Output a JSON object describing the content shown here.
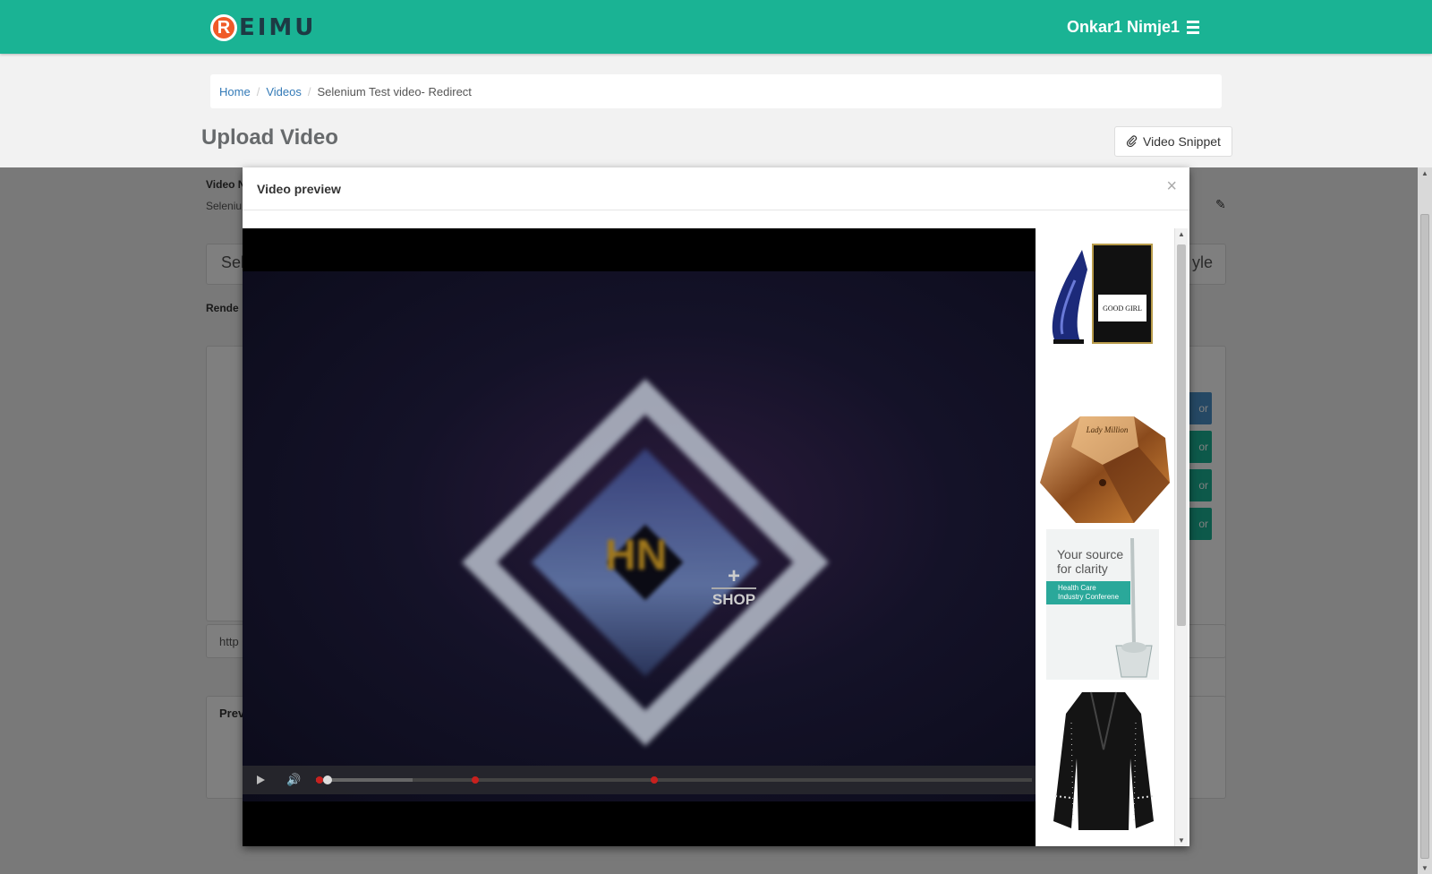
{
  "app": {
    "logo_letter": "R",
    "logo_text": "EIMU",
    "user_name": "Onkar1 Nimje1",
    "brand_color": "#1ab394"
  },
  "breadcrumb": {
    "home": "Home",
    "videos": "Videos",
    "current": "Selenium Test video- Redirect"
  },
  "page": {
    "title": "Upload Video",
    "snippet_button": "Video Snippet",
    "video_name_label": "Video N",
    "video_name_value": "Seleniu",
    "select_partial": "Sel",
    "style_partial": "yle",
    "render_label": "Rende",
    "url_partial": "http",
    "preview_label": "Prev",
    "side_button_text": "or"
  },
  "modal": {
    "title": "Video preview",
    "close": "×",
    "shop_label": "SHOP",
    "watermark_text": "HN"
  },
  "products": [
    {
      "name": "Good Girl perfume",
      "label": "GOOD GIRL"
    },
    {
      "name": "Lady Million perfume",
      "label": "Lady Million"
    },
    {
      "name": "Health care conference ad",
      "headline_1": "Your source",
      "headline_2": "for clarity",
      "banner_1": "Health Care",
      "banner_2": "Industry Conferene"
    },
    {
      "name": "Black blazer"
    }
  ],
  "player": {
    "progress_fraction": 0.01,
    "buffered_fraction": 0.135
  }
}
